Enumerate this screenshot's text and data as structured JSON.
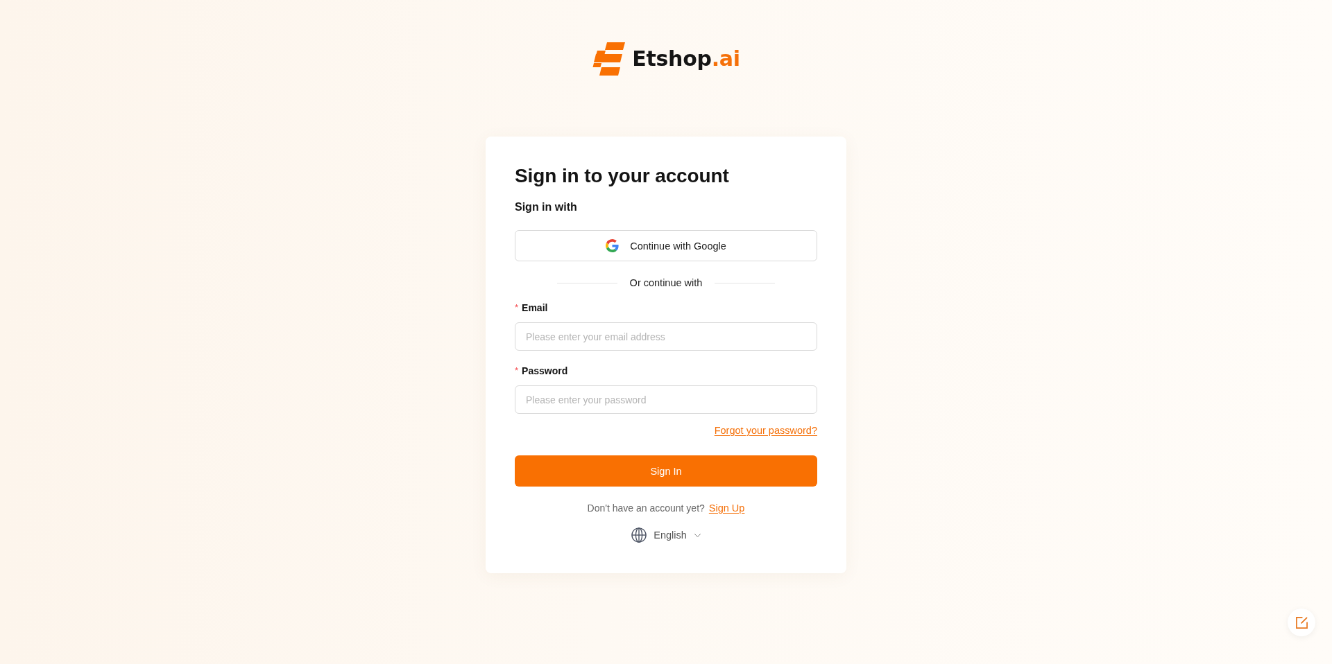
{
  "logo": {
    "name": "Etshop",
    "suffix": ".ai"
  },
  "card": {
    "title": "Sign in to your account",
    "subtitle": "Sign in with",
    "google_button": {
      "label": "Continue with Google"
    },
    "divider": {
      "label": "Or continue with"
    },
    "fields": [
      {
        "label": "Email",
        "required_mark": "*",
        "placeholder": "Please enter your email address"
      },
      {
        "label": "Password",
        "required_mark": "*",
        "placeholder": "Please enter your password"
      }
    ],
    "forgot_link": "Forgot your password?",
    "submit_button": "Sign In",
    "signup": {
      "prompt": "Don't have an account yet?",
      "link": "Sign Up"
    },
    "language": {
      "label": "English"
    }
  }
}
